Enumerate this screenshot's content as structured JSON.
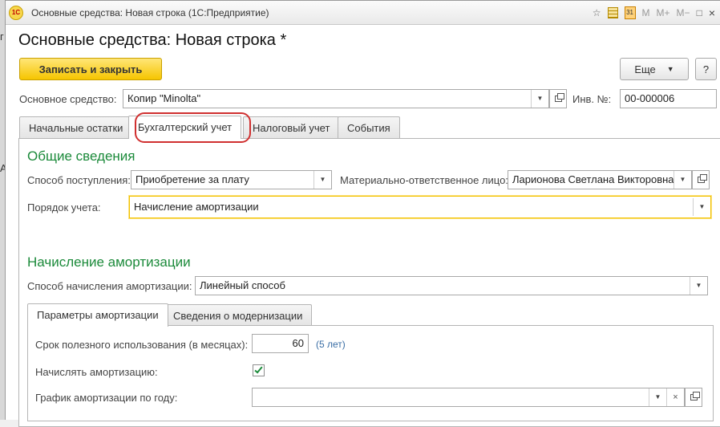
{
  "window": {
    "title": "Основные средства: Новая строка  (1С:Предприятие)",
    "app_icon": "1c-logo-icon",
    "toolbar_icons": [
      "star-icon",
      "grid-icon",
      "calendar-icon",
      "memory-m-icon",
      "memory-mplus-icon",
      "memory-mminus-icon",
      "restore-icon",
      "close-icon"
    ],
    "m_label": "M",
    "mplus_label": "M+",
    "mminus_label": "M−",
    "calendar_label": "31",
    "close_glyph": "×"
  },
  "background": {
    "letter_top": "г",
    "letter_bottom": "А"
  },
  "form": {
    "title": "Основные средства: Новая строка *",
    "save_close_label": "Записать и закрыть",
    "more_label": "Еще",
    "help_label": "?",
    "asset_label": "Основное средство:",
    "asset_value": "Копир \"Minolta\"",
    "inv_label": "Инв. №:",
    "inv_value": "00-000006"
  },
  "tabs": [
    {
      "label": "Начальные остатки",
      "active": false
    },
    {
      "label": "Бухгалтерский учет",
      "active": true
    },
    {
      "label": "Налоговый учет",
      "active": false
    },
    {
      "label": "События",
      "active": false
    }
  ],
  "general": {
    "title": "Общие сведения",
    "receipt_label": "Способ поступления:",
    "receipt_value": "Приобретение за плату",
    "mol_label": "Материально-ответственное лицо:",
    "mol_value": "Ларионова Светлана Викторовна",
    "order_label": "Порядок учета:",
    "order_value": "Начисление амортизации"
  },
  "depreciation": {
    "title": "Начисление амортизации",
    "method_label": "Способ начисления амортизации:",
    "method_value": "Линейный способ",
    "subtabs": [
      {
        "label": "Параметры амортизации",
        "active": true
      },
      {
        "label": "Сведения о модернизации",
        "active": false
      }
    ],
    "life_label": "Срок полезного использования (в месяцах):",
    "life_value": "60",
    "life_hint": "(5 лет)",
    "accrue_label": "Начислять амортизацию:",
    "accrue_checked": true,
    "schedule_label": "График амортизации по году:",
    "schedule_value": ""
  },
  "colors": {
    "accent_green": "#1b8a3a",
    "primary_button": "#f6c500",
    "focus_border": "#f2c200",
    "highlight_ring": "#d03030"
  }
}
